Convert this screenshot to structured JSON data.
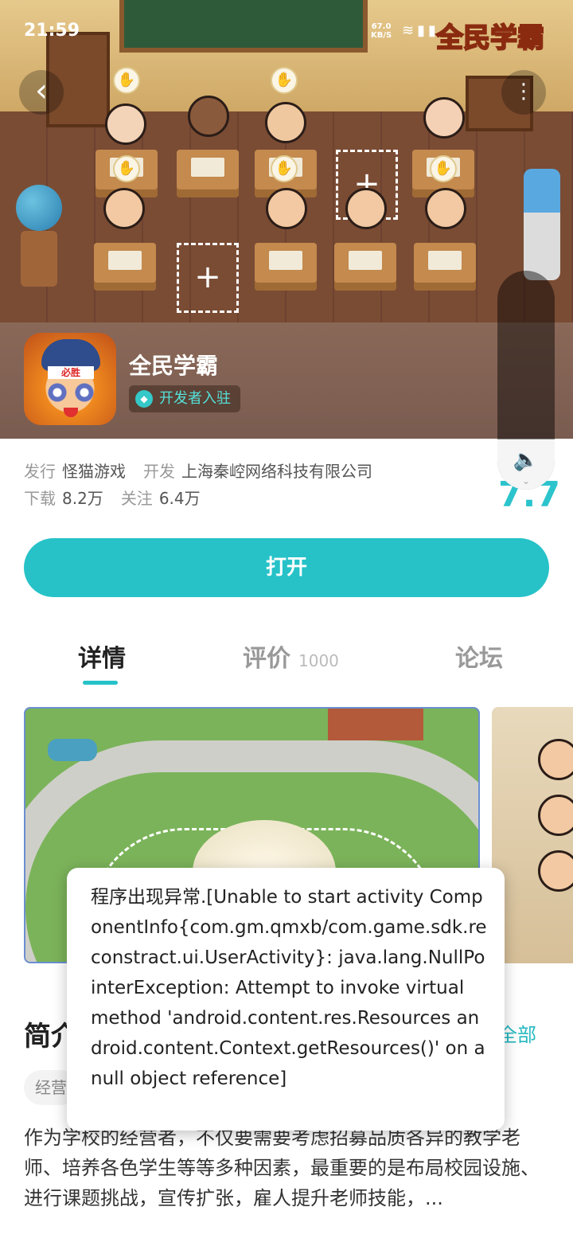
{
  "status_bar": {
    "time": "21:59",
    "net_speed_value": "67.0",
    "net_speed_unit": "KB/S",
    "icons": [
      "wifi-icon",
      "signal-icon",
      "battery-icon"
    ]
  },
  "hero": {
    "logo_text": "全民学霸",
    "back_icon": "‹",
    "more_icon": "⋮"
  },
  "app": {
    "name": "全民学霸",
    "icon_band_text": "必胜",
    "dev_badge": "开发者入驻"
  },
  "meta": {
    "publisher_label": "发行",
    "publisher": "怪猫游戏",
    "developer_label": "开发",
    "developer": "上海秦崆网络科技有限公司",
    "downloads_label": "下载",
    "downloads": "8.2万",
    "follows_label": "关注",
    "follows": "6.4万",
    "score": "7.7"
  },
  "volume": {
    "level": 0.23,
    "icon": "speaker-icon"
  },
  "open_button": "打开",
  "tabs": [
    {
      "label": "详情",
      "active": true
    },
    {
      "label": "评价",
      "count": "1000",
      "active": false
    },
    {
      "label": "论坛",
      "active": false
    }
  ],
  "intro": {
    "title": "简介",
    "more": "全部",
    "tag": "经营",
    "text": "作为学校的经营者，不仅要需要考虑招募品质各异的教学老师、培养各色学生等等多种因素，最重要的是布局校园设施、进行课题挑战，宣传扩张，雇人提升老师技能，..."
  },
  "toast": {
    "message": "程序出现异常.[Unable to start activity ComponentInfo{com.gm.qmxb/com.game.sdk.reconstract.ui.UserActivity}: java.lang.NullPointerException: Attempt to invoke virtual method 'android.content.res.Resources android.content.Context.getResources()' on a null object reference]"
  },
  "colors": {
    "accent": "#26c2c8",
    "score": "#2cc4cc"
  }
}
